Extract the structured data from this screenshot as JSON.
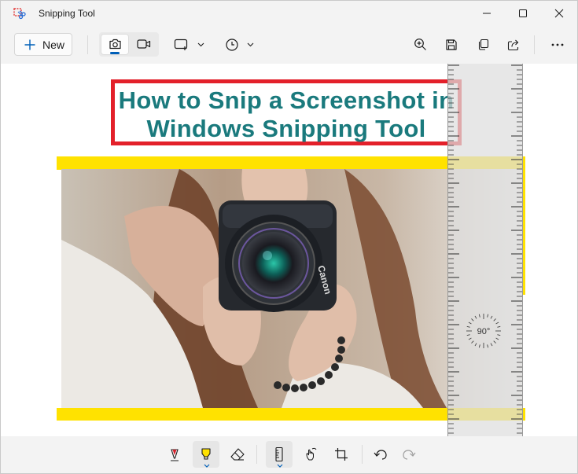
{
  "window": {
    "title": "Snipping Tool",
    "controls": [
      "minimize-icon",
      "maximize-icon",
      "close-icon"
    ]
  },
  "toolbar": {
    "new_label": "New",
    "mode": "screenshot",
    "snip_shape": "rectangle",
    "timer": "none",
    "actions": [
      "zoom-in-icon",
      "save-icon",
      "copy-icon",
      "share-icon",
      "more-icon"
    ]
  },
  "snip": {
    "title_line1": "How to Snip a Screenshot in",
    "title_line2": "Windows Snipping Tool",
    "title_color": "#1a7a7d",
    "box_color": "#e3202a",
    "highlight_color": "#ffe200",
    "photo_brand": "Canon"
  },
  "ruler": {
    "angle_label": "90°"
  },
  "bottom_tools": {
    "items": [
      "ballpoint-pen",
      "highlighter",
      "eraser",
      "ruler",
      "touch-writing",
      "crop",
      "undo",
      "redo"
    ],
    "selected": [
      "highlighter",
      "ruler"
    ]
  }
}
